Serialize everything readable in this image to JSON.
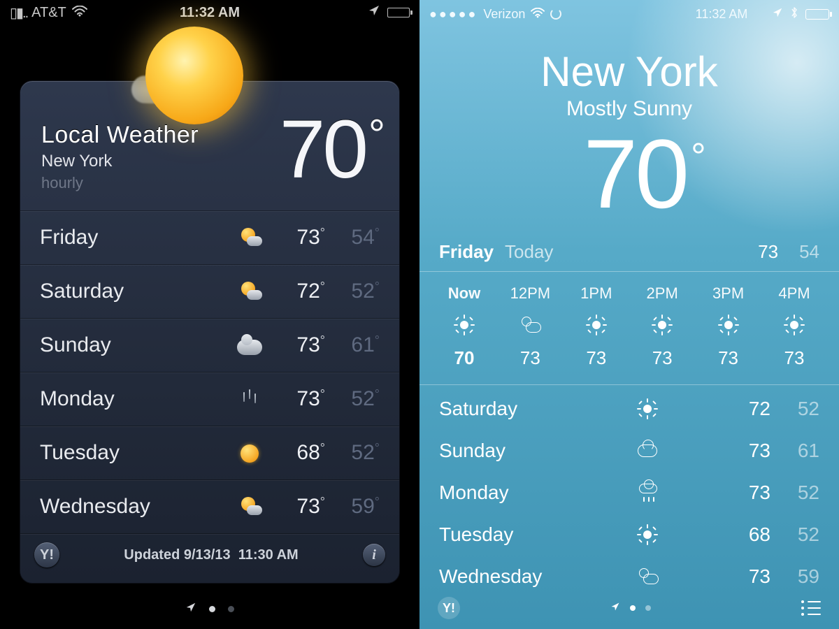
{
  "left": {
    "status": {
      "carrier": "AT&T",
      "time": "11:32 AM"
    },
    "header": {
      "title": "Local Weather",
      "city": "New York",
      "hourly_label": "hourly",
      "temp": "70",
      "deg": "°"
    },
    "forecast": [
      {
        "day": "Friday",
        "icon": "suncloud",
        "hi": "73",
        "lo": "54"
      },
      {
        "day": "Saturday",
        "icon": "suncloud",
        "hi": "72",
        "lo": "52"
      },
      {
        "day": "Sunday",
        "icon": "cloud",
        "hi": "73",
        "lo": "61"
      },
      {
        "day": "Monday",
        "icon": "rain",
        "hi": "73",
        "lo": "52"
      },
      {
        "day": "Tuesday",
        "icon": "sun",
        "hi": "68",
        "lo": "52"
      },
      {
        "day": "Wednesday",
        "icon": "suncloud",
        "hi": "73",
        "lo": "59"
      }
    ],
    "footer": {
      "yahoo": "Y!",
      "updated_label": "Updated",
      "updated_date": "9/13/13",
      "updated_time": "11:30 AM",
      "info": "i"
    }
  },
  "right": {
    "status": {
      "carrier": "Verizon",
      "time": "11:32 AM"
    },
    "header": {
      "city": "New York",
      "condition": "Mostly Sunny",
      "temp": "70",
      "deg": "°"
    },
    "today": {
      "day": "Friday",
      "label": "Today",
      "hi": "73",
      "lo": "54"
    },
    "hourly": [
      {
        "label": "Now",
        "icon": "sun",
        "temp": "70",
        "bold": true
      },
      {
        "label": "12PM",
        "icon": "partly",
        "temp": "73"
      },
      {
        "label": "1PM",
        "icon": "sun",
        "temp": "73"
      },
      {
        "label": "2PM",
        "icon": "sun",
        "temp": "73"
      },
      {
        "label": "3PM",
        "icon": "sun",
        "temp": "73"
      },
      {
        "label": "4PM",
        "icon": "sun",
        "temp": "73"
      }
    ],
    "daily": [
      {
        "day": "Saturday",
        "icon": "sun",
        "hi": "72",
        "lo": "52"
      },
      {
        "day": "Sunday",
        "icon": "cloud",
        "hi": "73",
        "lo": "61"
      },
      {
        "day": "Monday",
        "icon": "rain",
        "hi": "73",
        "lo": "52"
      },
      {
        "day": "Tuesday",
        "icon": "sun",
        "hi": "68",
        "lo": "52"
      },
      {
        "day": "Wednesday",
        "icon": "partly",
        "hi": "73",
        "lo": "59"
      }
    ],
    "footer": {
      "yahoo": "Y!"
    }
  }
}
